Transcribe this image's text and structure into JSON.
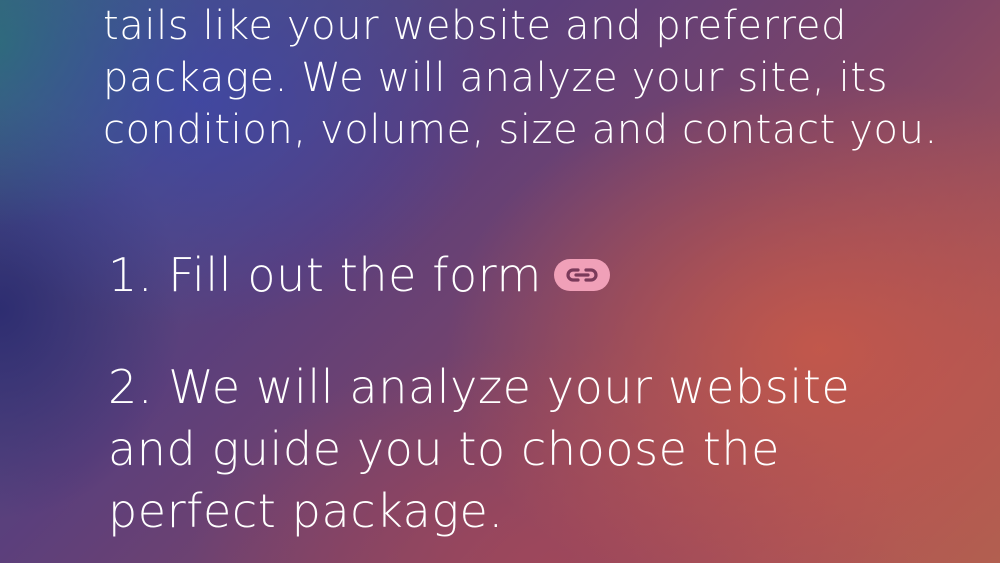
{
  "intro": {
    "text": "tails like your website and preferred package. We will analyze your site, its condition, volume, size and contact you."
  },
  "steps": [
    {
      "label": "1. Fill out the form",
      "link_icon": "link-icon"
    },
    {
      "label": "2. We will analyze your website and guide you to choose the perfect package."
    }
  ],
  "colors": {
    "link_icon": "#f0a0b8",
    "text": "#ffffff"
  }
}
